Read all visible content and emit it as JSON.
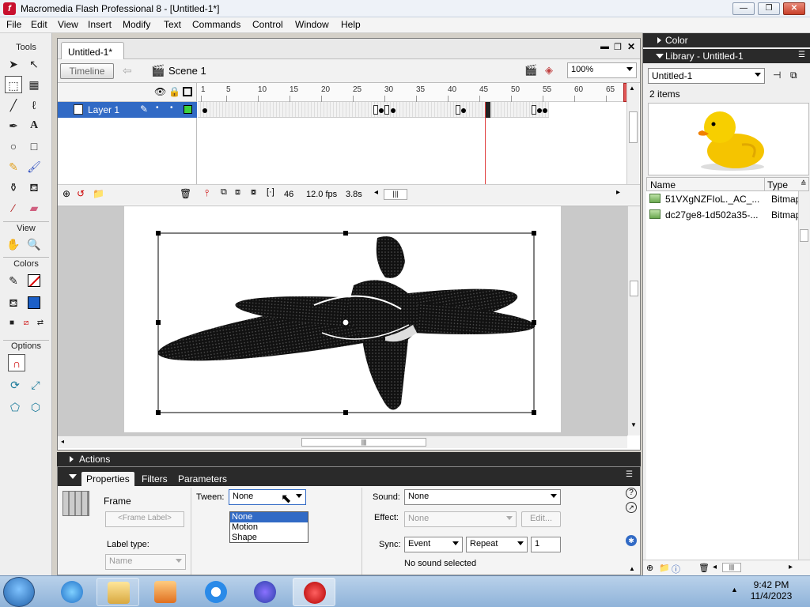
{
  "window": {
    "title": "Macromedia Flash Professional 8 - [Untitled-1*]",
    "min": "—",
    "restore": "❐",
    "close": "✕"
  },
  "menu": [
    "File",
    "Edit",
    "View",
    "Insert",
    "Modify",
    "Text",
    "Commands",
    "Control",
    "Window",
    "Help"
  ],
  "tools": {
    "title": "Tools",
    "view_label": "View",
    "colors_label": "Colors",
    "options_label": "Options"
  },
  "document": {
    "tab": "Untitled-1*",
    "timeline_button": "Timeline",
    "scene": "Scene 1",
    "zoom": "100%"
  },
  "timeline": {
    "layer_name": "Layer 1",
    "ruler": [
      "1",
      "5",
      "10",
      "15",
      "20",
      "25",
      "30",
      "35",
      "40",
      "45",
      "50",
      "55",
      "60",
      "65"
    ],
    "current_frame": "46",
    "frame_rate": "12.0 fps",
    "elapsed": "3.8s"
  },
  "actions_panel": {
    "title": "Actions"
  },
  "properties": {
    "tabs": [
      "Properties",
      "Filters",
      "Parameters"
    ],
    "type": "Frame",
    "frame_label_placeholder": "<Frame Label>",
    "label_type_label": "Label type:",
    "label_type_value": "Name",
    "tween_label": "Tween:",
    "tween_value": "None",
    "tween_options": [
      "None",
      "Motion",
      "Shape"
    ],
    "sound_label": "Sound:",
    "sound_value": "None",
    "effect_label": "Effect:",
    "effect_value": "None",
    "edit_button": "Edit...",
    "sync_label": "Sync:",
    "sync_value": "Event",
    "repeat_value": "Repeat",
    "repeat_count": "1",
    "status": "No sound selected"
  },
  "color_panel": {
    "title": "Color"
  },
  "library": {
    "title": "Library - Untitled-1",
    "doc_select": "Untitled-1",
    "count": "2 items",
    "columns": {
      "name": "Name",
      "type": "Type"
    },
    "items": [
      {
        "name": "51VXgNZFIoL._AC_...",
        "type": "Bitmap"
      },
      {
        "name": "dc27ge8-1d502a35-...",
        "type": "Bitmap"
      }
    ]
  },
  "taskbar": {
    "time": "9:42 PM",
    "date": "11/4/2023"
  }
}
